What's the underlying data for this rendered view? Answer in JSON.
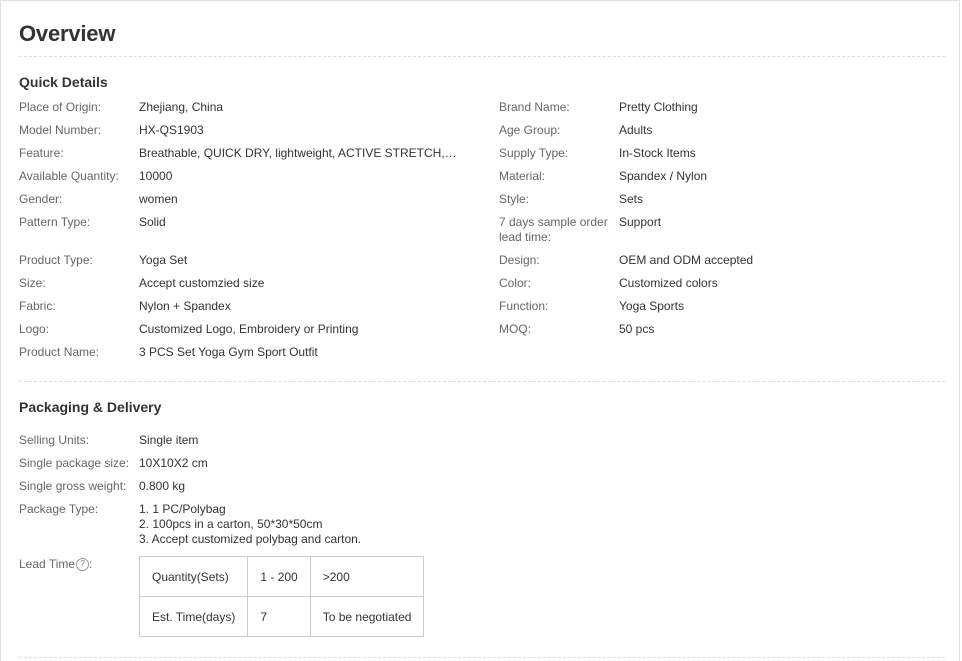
{
  "page": {
    "title": "Overview"
  },
  "quick_details": {
    "title": "Quick Details",
    "left": [
      {
        "label": "Place of Origin:",
        "value": "Zhejiang, China"
      },
      {
        "label": "Model Number:",
        "value": "HX-QS1903"
      },
      {
        "label": "Feature:",
        "value": "Breathable, QUICK DRY, lightweight, ACTIVE STRETCH, Swe..."
      },
      {
        "label": "Available Quantity:",
        "value": "10000"
      },
      {
        "label": "Gender:",
        "value": "women"
      },
      {
        "label": "Pattern Type:",
        "value": "Solid"
      },
      {
        "label": "Product Type:",
        "value": "Yoga Set"
      },
      {
        "label": "Size:",
        "value": "Accept customzied size"
      },
      {
        "label": "Fabric:",
        "value": "Nylon + Spandex"
      },
      {
        "label": "Logo:",
        "value": "Customized Logo, Embroidery or Printing"
      },
      {
        "label": "Product Name:",
        "value": "3 PCS Set Yoga Gym Sport Outfit"
      }
    ],
    "right": [
      {
        "label": "Brand Name:",
        "value": "Pretty Clothing"
      },
      {
        "label": "Age Group:",
        "value": "Adults"
      },
      {
        "label": "Supply Type:",
        "value": "In-Stock Items"
      },
      {
        "label": "Material:",
        "value": "Spandex / Nylon"
      },
      {
        "label": "Style:",
        "value": "Sets"
      },
      {
        "label": "7 days sample order lead time:",
        "value": "Support"
      },
      {
        "label": "Design:",
        "value": "OEM and ODM accepted"
      },
      {
        "label": "Color:",
        "value": "Customized colors"
      },
      {
        "label": "Function:",
        "value": "Yoga Sports"
      },
      {
        "label": "MOQ:",
        "value": "50 pcs"
      }
    ]
  },
  "packaging": {
    "title": "Packaging & Delivery",
    "rows": [
      {
        "label": "Selling Units:",
        "value": "Single item"
      },
      {
        "label": "Single package size:",
        "value": "10X10X2 cm"
      },
      {
        "label": "Single gross weight:",
        "value": "0.800 kg"
      }
    ],
    "package_type": {
      "label": "Package Type:",
      "lines": [
        "1. 1 PC/Polybag",
        "2. 100pcs in a carton, 50*30*50cm",
        "3. Accept customized polybag and carton."
      ]
    },
    "lead_time": {
      "label": "Lead Time",
      "help_icon": "?",
      "table": [
        [
          "Quantity(Sets)",
          "1 - 200",
          ">200"
        ],
        [
          "Est. Time(days)",
          "7",
          "To be negotiated"
        ]
      ]
    }
  }
}
